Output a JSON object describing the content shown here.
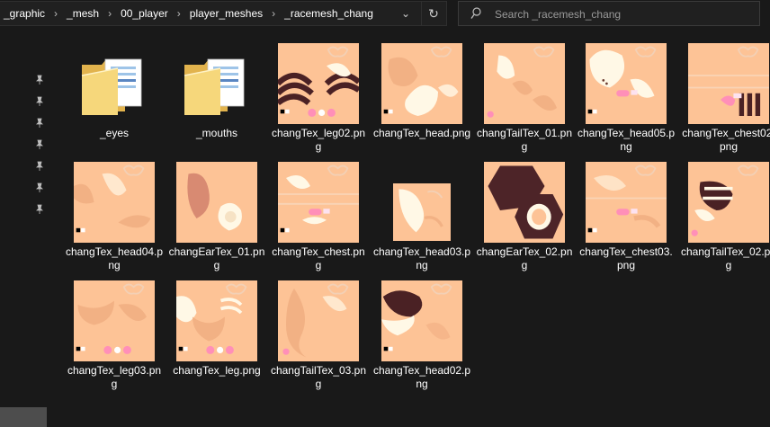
{
  "address": {
    "crumbs": [
      "_graphic",
      "_mesh",
      "00_player",
      "player_meshes",
      "_racemesh_chang"
    ],
    "separator": "›",
    "dropdown_glyph": "⌄",
    "refresh_glyph": "↻"
  },
  "search": {
    "placeholder": "Search _racemesh_chang"
  },
  "items": [
    {
      "label": "_eyes",
      "kind": "folder",
      "tex": "folder"
    },
    {
      "label": "_mouths",
      "kind": "folder",
      "tex": "folder"
    },
    {
      "label": "changTex_leg02.png",
      "kind": "image",
      "tex": "legstripes"
    },
    {
      "label": "changTex_head.png",
      "kind": "image",
      "tex": "head"
    },
    {
      "label": "changTailTex_01.png",
      "kind": "image",
      "tex": "tail"
    },
    {
      "label": "changTex_head05.png",
      "kind": "image",
      "tex": "head5"
    },
    {
      "label": "changTex_chest02.png",
      "kind": "image",
      "tex": "cheststripes"
    },
    {
      "label": "changTex_head04.png",
      "kind": "image",
      "tex": "head4"
    },
    {
      "label": "changEarTex_01.png",
      "kind": "image",
      "tex": "ear"
    },
    {
      "label": "changTex_chest.png",
      "kind": "image",
      "tex": "chest"
    },
    {
      "label": "changTex_head03.png",
      "kind": "image",
      "tex": "small"
    },
    {
      "label": "changEarTex_02.png",
      "kind": "image",
      "tex": "ear2"
    },
    {
      "label": "changTex_chest03.png",
      "kind": "image",
      "tex": "chest3"
    },
    {
      "label": "changTailTex_02.png",
      "kind": "image",
      "tex": "tail2"
    },
    {
      "label": "changTex_leg03.png",
      "kind": "image",
      "tex": "leg"
    },
    {
      "label": "changTex_leg.png",
      "kind": "image",
      "tex": "leg2"
    },
    {
      "label": "changTailTex_03.png",
      "kind": "image",
      "tex": "tail3"
    },
    {
      "label": "changTex_head02.png",
      "kind": "image",
      "tex": "head2"
    }
  ],
  "colors": {
    "window_bg": "#191919",
    "skin": "#fdc396",
    "skin_dark": "#f2b184",
    "cream": "#fff8e6",
    "dark_stripe": "#4a2124",
    "pink": "#ff8fb8",
    "folder": "#f6d77b"
  }
}
